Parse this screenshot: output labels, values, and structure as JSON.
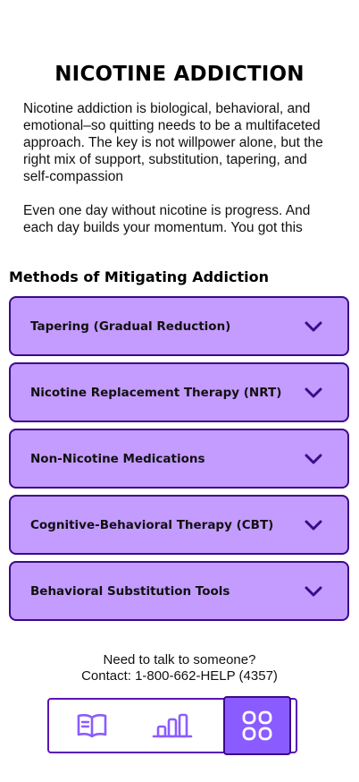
{
  "page_title": "NICOTINE ADDICTION",
  "intro": {
    "paragraph1": "Nicotine addiction is biological, behavioral, and emotional–so quitting needs to be a multifaceted approach. The key is not willpower alone, but the right mix of support, substitution, tapering, and self-compassion",
    "paragraph2": "Even one day without nicotine is progress. And each day builds your momentum. You got this"
  },
  "methods": {
    "heading": "Methods of Mitigating Addiction",
    "items": [
      {
        "label": "Tapering (Gradual Reduction)"
      },
      {
        "label": "Nicotine Replacement Therapy (NRT)"
      },
      {
        "label": "Non-Nicotine Medications"
      },
      {
        "label": "Cognitive-Behavioral Therapy (CBT)"
      },
      {
        "label": "Behavioral Substitution Tools"
      }
    ]
  },
  "contact": {
    "line1": "Need to talk to someone?",
    "line2": "Contact: 1-800-662-HELP (4357)"
  },
  "nav": {
    "items": [
      {
        "icon": "book-icon",
        "active": false
      },
      {
        "icon": "bar-chart-icon",
        "active": false
      },
      {
        "icon": "grid-icon",
        "active": true
      }
    ]
  },
  "colors": {
    "accordion_bg": "#c49bff",
    "accordion_border": "#3a0a8a",
    "accent": "#8a5cff",
    "nav_border": "#5b13b8"
  }
}
